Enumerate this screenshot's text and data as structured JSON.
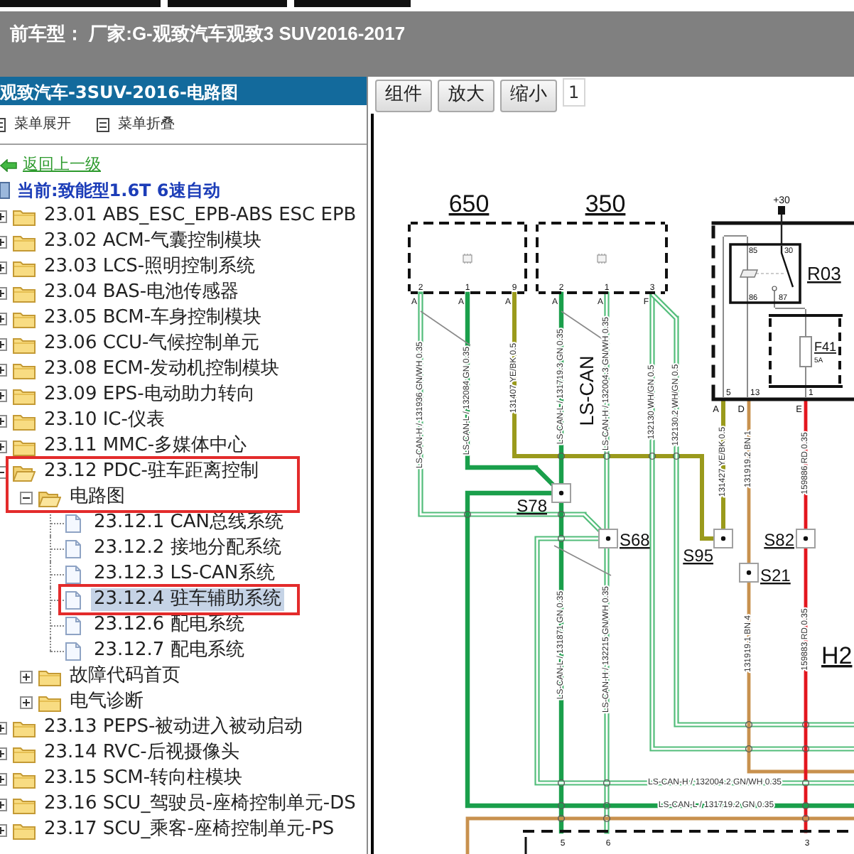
{
  "header": {
    "vehicle": "前车型： 厂家:G-观致汽车观致3 SUV2016-2017"
  },
  "sidebar": {
    "title": "观致汽车-3SUV-2016-电路图",
    "actions": [
      {
        "label": "菜单展开"
      },
      {
        "label": "菜单折叠"
      }
    ],
    "back_link": "返回上一级",
    "current": "当前:致能型1.6T 6速自动",
    "tree": [
      {
        "kind": "folder",
        "label": "23.01 ABS_ESC_EPB-ABS ESC EPB",
        "expanded": false,
        "selected": false,
        "outlined": false
      },
      {
        "kind": "folder",
        "label": "23.02 ACM-气囊控制模块",
        "expanded": false,
        "selected": false,
        "outlined": false
      },
      {
        "kind": "folder",
        "label": "23.03 LCS-照明控制系统",
        "expanded": false,
        "selected": false,
        "outlined": false
      },
      {
        "kind": "folder",
        "label": "23.04 BAS-电池传感器",
        "expanded": false,
        "selected": false,
        "outlined": false
      },
      {
        "kind": "folder",
        "label": "23.05 BCM-车身控制模块",
        "expanded": false,
        "selected": false,
        "outlined": false
      },
      {
        "kind": "folder",
        "label": "23.06 CCU-气候控制单元",
        "expanded": false,
        "selected": false,
        "outlined": false
      },
      {
        "kind": "folder",
        "label": "23.08 ECM-发动机控制模块",
        "expanded": false,
        "selected": false,
        "outlined": false
      },
      {
        "kind": "folder",
        "label": "23.09 EPS-电动助力转向",
        "expanded": false,
        "selected": false,
        "outlined": false
      },
      {
        "kind": "folder",
        "label": "23.10 IC-仪表",
        "expanded": false,
        "selected": false,
        "outlined": false
      },
      {
        "kind": "folder",
        "label": "23.11 MMC-多媒体中心",
        "expanded": false,
        "selected": false,
        "outlined": false
      },
      {
        "kind": "folder",
        "label": "23.12 PDC-驻车距离控制",
        "expanded": true,
        "selected": false,
        "outlined": true,
        "children": [
          {
            "kind": "folder",
            "label": "电路图",
            "expanded": true,
            "selected": false,
            "outlined": true,
            "children": [
              {
                "kind": "page",
                "label": "23.12.1 CAN总线系统",
                "selected": false,
                "outlined": false
              },
              {
                "kind": "page",
                "label": "23.12.2 接地分配系统",
                "selected": false,
                "outlined": false
              },
              {
                "kind": "page",
                "label": "23.12.3 LS-CAN系统",
                "selected": false,
                "outlined": false
              },
              {
                "kind": "page",
                "label": "23.12.4 驻车辅助系统",
                "selected": true,
                "outlined": true
              },
              {
                "kind": "page",
                "label": "23.12.6 配电系统",
                "selected": false,
                "outlined": false
              },
              {
                "kind": "page",
                "label": "23.12.7 配电系统",
                "selected": false,
                "outlined": false
              }
            ]
          },
          {
            "kind": "folder",
            "label": "故障代码首页",
            "expanded": false,
            "selected": false,
            "outlined": false
          },
          {
            "kind": "folder",
            "label": "电气诊断",
            "expanded": false,
            "selected": false,
            "outlined": false
          }
        ]
      },
      {
        "kind": "folder",
        "label": "23.13 PEPS-被动进入被动启动",
        "expanded": false,
        "selected": false,
        "outlined": false
      },
      {
        "kind": "folder",
        "label": "23.14 RVC-后视摄像头",
        "expanded": false,
        "selected": false,
        "outlined": false
      },
      {
        "kind": "folder",
        "label": "23.15 SCM-转向柱模块",
        "expanded": false,
        "selected": false,
        "outlined": false
      },
      {
        "kind": "folder",
        "label": "23.16 SCU_驾驶员-座椅控制单元-DS",
        "expanded": false,
        "selected": false,
        "outlined": false
      },
      {
        "kind": "folder",
        "label": "23.17 SCU_乘客-座椅控制单元-PS",
        "expanded": false,
        "selected": false,
        "outlined": false
      }
    ]
  },
  "toolbar": {
    "buttons": [
      {
        "label": "组件"
      },
      {
        "label": "放大"
      },
      {
        "label": "缩小"
      }
    ],
    "page": "1"
  },
  "diagram": {
    "modules": [
      {
        "label": "650",
        "pins": [
          {
            "number": "2",
            "connector": "A"
          },
          {
            "number": "1",
            "connector": "A"
          },
          {
            "number": "9",
            "connector": "A"
          }
        ]
      },
      {
        "label": "350",
        "pins": [
          {
            "number": "2",
            "connector": "A"
          },
          {
            "number": "1",
            "connector": "A"
          },
          {
            "number": "3",
            "connector": "F"
          }
        ]
      }
    ],
    "supply": "+30",
    "relay": {
      "label": "R03",
      "terminals": [
        "85",
        "30",
        "86",
        "87"
      ]
    },
    "fuse": {
      "label": "F41",
      "rating": "5A"
    },
    "unit_pins": [
      {
        "number": "5",
        "connector": "A"
      },
      {
        "number": "13",
        "connector": "D"
      },
      {
        "number": "1",
        "connector": "E"
      }
    ],
    "bus_label": "LS-CAN",
    "wires": [
      {
        "kind": "striped",
        "color": "#52bd7a",
        "labels": [
          "LS-CAN-H / 131936 GN/WH 0.35"
        ]
      },
      {
        "kind": "solid",
        "color": "#1a9f4b",
        "labels": [
          "LS-CAN-L / 132084 GN 0.35"
        ]
      },
      {
        "kind": "solid",
        "color": "#9a9a1c",
        "labels": [
          "131407 YE/BK 0.5"
        ]
      },
      {
        "kind": "solid",
        "color": "#1a9f4b",
        "labels": [
          "LS-CAN-L / 131719.3 GN 0.35",
          "LS-CAN-L / 131871 GN 0.35"
        ]
      },
      {
        "kind": "striped",
        "color": "#52bd7a",
        "labels": [
          "LS-CAN-H / 132004.3 GN/WH 0.35",
          "LS-CAN-H / 132215 GN/WH 0.35"
        ]
      },
      {
        "kind": "striped",
        "color": "#52bd7a",
        "labels": [
          "132130 WH/GN 0.5"
        ]
      },
      {
        "kind": "striped",
        "color": "#52bd7a",
        "labels": [
          "132130.2 WH/GN 0.5"
        ]
      },
      {
        "kind": "solid",
        "color": "#9a9a1c",
        "labels": [
          "131427 YE/BK 0.5"
        ]
      },
      {
        "kind": "solid",
        "color": "#c8914e",
        "labels": [
          "131919.2 BN 1",
          "131919.1 BN 4"
        ]
      },
      {
        "kind": "solid",
        "color": "#e3161e",
        "labels": [
          "159886 RD 0.35",
          "159883 RD 0.35"
        ]
      },
      {
        "kind": "striped",
        "color": "#52bd7a",
        "labels": [
          "LS-CAN-H / 132004.2 GN/WH 0.35"
        ]
      },
      {
        "kind": "solid",
        "color": "#1a9f4b",
        "labels": [
          "LS-CAN-L / 131719.2 GN 0.35"
        ]
      },
      {
        "kind": "solid",
        "color": "#c8914e"
      }
    ],
    "splices": [
      "S78",
      "S68",
      "S95",
      "S21",
      "S82"
    ],
    "harness": "H2",
    "bottom_pins": [
      "5",
      "6",
      "3"
    ]
  }
}
